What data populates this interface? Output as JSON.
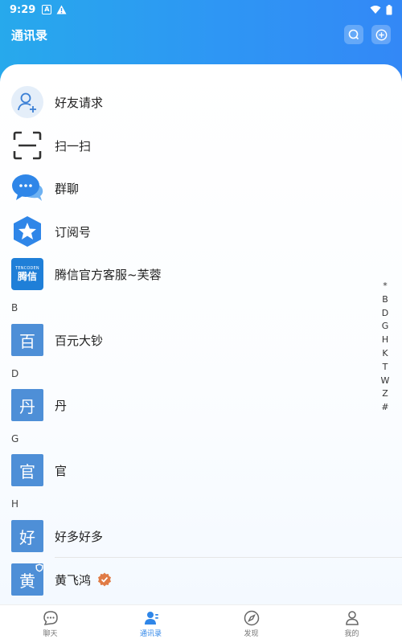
{
  "status_bar": {
    "time": "9:29",
    "icons": [
      "a-box-icon",
      "warning-icon",
      "wifi-icon",
      "battery-icon"
    ]
  },
  "app_bar": {
    "title": "通讯录"
  },
  "quick_items": [
    {
      "label": "好友请求",
      "icon": "add-friend-icon"
    },
    {
      "label": "扫一扫",
      "icon": "scan-icon"
    },
    {
      "label": "群聊",
      "icon": "group-chat-icon"
    },
    {
      "label": "订阅号",
      "icon": "subscription-icon"
    },
    {
      "label": "腾信官方客服~芙蓉",
      "icon": "tencent-service-logo",
      "logo_small": "TENCODEN",
      "logo_big": "腾信"
    }
  ],
  "sections": [
    {
      "letter": "B",
      "contacts": [
        {
          "avatar": "百",
          "name": "百元大钞"
        }
      ]
    },
    {
      "letter": "D",
      "contacts": [
        {
          "avatar": "丹",
          "name": "丹"
        }
      ]
    },
    {
      "letter": "G",
      "contacts": [
        {
          "avatar": "官",
          "name": "官"
        }
      ]
    },
    {
      "letter": "H",
      "contacts": [
        {
          "avatar": "好",
          "name": "好多好多"
        },
        {
          "avatar": "黄",
          "name": "黄飞鸿",
          "verified": true
        }
      ]
    }
  ],
  "index_letters": [
    "*",
    "B",
    "D",
    "G",
    "H",
    "K",
    "T",
    "W",
    "Z",
    "#"
  ],
  "tabs": [
    {
      "label": "聊天",
      "icon": "chat-icon",
      "active": false
    },
    {
      "label": "通讯录",
      "icon": "contacts-icon",
      "active": true
    },
    {
      "label": "发现",
      "icon": "compass-icon",
      "active": false
    },
    {
      "label": "我的",
      "icon": "profile-icon",
      "active": false
    }
  ],
  "colors": {
    "header_start": "#27a9ec",
    "header_end": "#3388f6",
    "avatar_bg": "#4e8fd7",
    "active_tab": "#2f86e8",
    "verified_badge": "#e07b45"
  }
}
